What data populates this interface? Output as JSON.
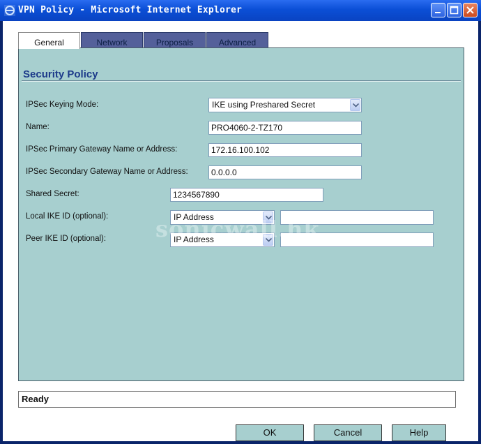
{
  "window": {
    "title": "VPN Policy - Microsoft Internet Explorer"
  },
  "tabs": [
    {
      "label": "General",
      "active": true
    },
    {
      "label": "Network",
      "active": false
    },
    {
      "label": "Proposals",
      "active": false
    },
    {
      "label": "Advanced",
      "active": false
    }
  ],
  "section": {
    "title": "Security Policy"
  },
  "form": {
    "keying_mode": {
      "label": "IPSec Keying Mode:",
      "value": "IKE using Preshared Secret"
    },
    "name": {
      "label": "Name:",
      "value": "PRO4060-2-TZ170"
    },
    "primary_gateway": {
      "label": "IPSec Primary Gateway Name or Address:",
      "value": "172.16.100.102"
    },
    "secondary_gateway": {
      "label": "IPSec Secondary Gateway Name or Address:",
      "value": "0.0.0.0"
    },
    "shared_secret": {
      "label": "Shared Secret:",
      "value": "1234567890"
    },
    "local_ike_id": {
      "label": "Local IKE ID (optional):",
      "type": "IP Address",
      "value": ""
    },
    "peer_ike_id": {
      "label": "Peer IKE ID (optional):",
      "type": "IP Address",
      "value": ""
    }
  },
  "watermark": "sonicwall.hk",
  "status": "Ready",
  "buttons": {
    "ok": "OK",
    "cancel": "Cancel",
    "help": "Help"
  },
  "colors": {
    "titlebar": "#0b4fd6",
    "panel": "#a7cfcf",
    "tab_inactive": "#54609a",
    "section_title": "#1d3b8a"
  }
}
